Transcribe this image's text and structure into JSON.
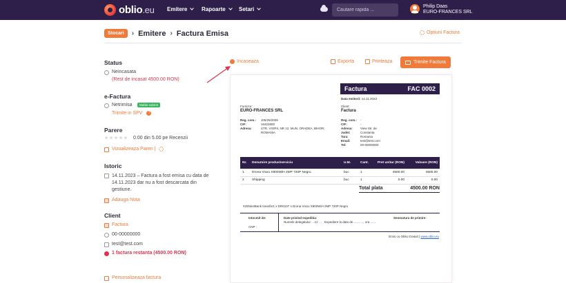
{
  "nav": {
    "brand": "oblio",
    "brand_tld": ".eu",
    "items": [
      {
        "label": "Emitere"
      },
      {
        "label": "Rapoarte"
      },
      {
        "label": "Setari"
      }
    ],
    "search_placeholder": "Cautare rapida ...",
    "user_name": "Philip Daas",
    "user_company": "EURO-FRANCES SRL"
  },
  "breadcrumb": {
    "back_label": "Stocari",
    "section": "Emitere",
    "current": "Factura Emisa"
  },
  "options_label": "Optiuni Factura",
  "status": {
    "title": "Status",
    "value": "Neincasata",
    "remaining": "(Rest de incasat 4500.00 RON)"
  },
  "efactura": {
    "title": "e-Factura",
    "value": "Netrimisa",
    "badge": "Stable submit",
    "send_link": "Trimite in SPV"
  },
  "reviews": {
    "title": "Parere",
    "score": "0.00 din 5.00 pe Recenzii",
    "view_link": "Vizualizeaza Pareri |"
  },
  "history": {
    "title": "Istoric",
    "entry": "14.11.2023 – Factura a fost emisa cu data de 14.11.2023 dar nu a fost descarcata din gestiune.",
    "add_note": "Adauga Nota"
  },
  "client": {
    "title": "Client",
    "name": "Factura",
    "phone": "00-00000000",
    "email": "test@test.com",
    "outstanding": "1 factura restanta (4500.00 RON)"
  },
  "customize_label": "Personalizeaza factura",
  "actions": {
    "collect": "Incaseaza",
    "export": "Exporta",
    "print": "Printeaza",
    "send": "Trimite Factura"
  },
  "invoice": {
    "title": "Factura",
    "number": "FAC 0002",
    "issue_label": "Data emiterii:",
    "issue_date": "14.11.2023",
    "supplier_label": "Furnizor:",
    "supplier_name": "EURO-FRANCES SRL",
    "supplier_fields": [
      {
        "k": "Reg. com.:",
        "v": "J05/25/2009"
      },
      {
        "k": "CIF:",
        "v": "16422800"
      },
      {
        "k": "Adresa:",
        "v": "STR. VIORII, NR 12, MUN. ORADEA, BIHOR, ROMANIA"
      }
    ],
    "client_label": "Client:",
    "client_name": "Factura",
    "client_fields": [
      {
        "k": "Reg. com.:",
        "v": "-"
      },
      {
        "k": "CIF:",
        "v": "-"
      },
      {
        "k": "Adresa:",
        "v": "View Str. de"
      },
      {
        "k": "Judet:",
        "v": "Constanta"
      },
      {
        "k": "Tara:",
        "v": "Romania"
      },
      {
        "k": "Email:",
        "v": "test@test.com"
      },
      {
        "k": "Tel:",
        "v": "00-00000000"
      }
    ],
    "columns": [
      "Nr.",
      "Denumire produs/serviciu",
      "U.M.",
      "Cant.",
      "Pret unitar (RON)",
      "Valoare (RON)"
    ],
    "rows": [
      [
        "1",
        "Drona Vixxo X800WiH 2MP 720P Negru",
        "buc",
        "1",
        "4500.00",
        "4500.00"
      ],
      [
        "2",
        "Shipping",
        "buc",
        "1",
        "0.00",
        "0.00"
      ]
    ],
    "total_label": "Total plata",
    "total_value": "4500.00 RON",
    "note": "#25NextBank transfer1 x DR0107 x Drona Vixxo X800WiH 2MP 720P Negru",
    "sig_left": "Intocmit de:",
    "sig_cnp": "CNP :",
    "sig_mid_title": "Date privind expeditia:",
    "sig_mid_text": "Numele delegatului: ...Ci: . . . Expediere la data de ..........., ora ......",
    "sig_right": "Semnatura de primire:",
    "footer_prefix": "Emis cu Oblio Gratuit |",
    "footer_link": "www.oblio.eu"
  }
}
